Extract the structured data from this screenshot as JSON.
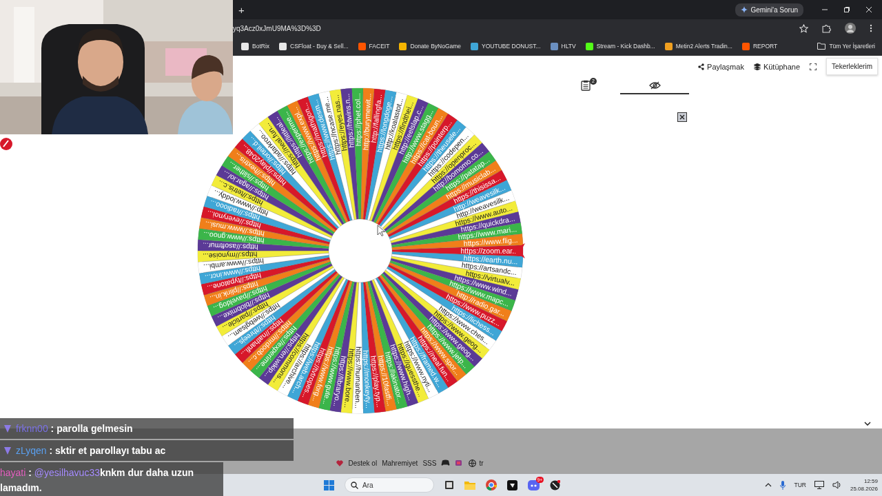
{
  "browser": {
    "new_tab": "+",
    "assistant_button": "Gemini'a Sorun",
    "address": "yq3Acz0xJmU9MA%3D%3D",
    "bookmarks": [
      {
        "label": "BotRix",
        "color": "#e8e8e8"
      },
      {
        "label": "CSFloat - Buy & Sell...",
        "color": "#e8e8e8"
      },
      {
        "label": "FACEIT",
        "color": "#ff5500"
      },
      {
        "label": "Donate ByNoGame",
        "color": "#f5b400"
      },
      {
        "label": "YOUTUBE DONUST...",
        "color": "#3fa6d6"
      },
      {
        "label": "HLTV",
        "color": "#6a8fc0"
      },
      {
        "label": "Stream - Kick Dashb...",
        "color": "#53fc18"
      },
      {
        "label": "Metin2 Alerts Tradin...",
        "color": "#f0a020"
      },
      {
        "label": "REPORT",
        "color": "#ff5500"
      }
    ],
    "all_bookmarks": "Tüm Yer İşaretleri"
  },
  "header": {
    "share": "Paylaşmak",
    "library": "Kütüphane",
    "my_wheels": "Tekerleklerim"
  },
  "panel_tabs": [
    {
      "kind": "entries",
      "badge": "2",
      "selected": false
    },
    {
      "kind": "hidden",
      "selected": true
    }
  ],
  "wheel": {
    "segments": [
      {
        "label": "https://zoom.ear...",
        "color": "#d7182a"
      },
      {
        "label": "https://earth.nu...",
        "color": "#3fa6d6"
      },
      {
        "label": "https://artsandc...",
        "color": "#ffffff"
      },
      {
        "label": "https://virtualv...",
        "color": "#f2ec3a"
      },
      {
        "label": "https://www.wind...",
        "color": "#5b3a96"
      },
      {
        "label": "https://www.mapc...",
        "color": "#3bb54a"
      },
      {
        "label": "http://radio.gar...",
        "color": "#f07f1a"
      },
      {
        "label": "https://www.puzz...",
        "color": "#d7182a"
      },
      {
        "label": "https://lichess...",
        "color": "#3fa6d6"
      },
      {
        "label": "https://www.ches...",
        "color": "#ffffff"
      },
      {
        "label": "https://www.geog...",
        "color": "#f2ec3a"
      },
      {
        "label": "https://www.geog...",
        "color": "#5b3a96"
      },
      {
        "label": "https://www.jetp...",
        "color": "#3bb54a"
      },
      {
        "label": "https://www.spor...",
        "color": "#f07f1a"
      },
      {
        "label": "https://neal.fun...",
        "color": "#d7182a"
      },
      {
        "label": "https://framed.w...",
        "color": "#3fa6d6"
      },
      {
        "label": "https://www.nyti...",
        "color": "#ffffff"
      },
      {
        "label": "https://guessthe...",
        "color": "#f2ec3a"
      },
      {
        "label": "https://www.high...",
        "color": "#5b3a96"
      },
      {
        "label": "https://akinator...",
        "color": "#3bb54a"
      },
      {
        "label": "https://10fastfi...",
        "color": "#f07f1a"
      },
      {
        "label": "https://play.typ...",
        "color": "#d7182a"
      },
      {
        "label": "https://monkeyty...",
        "color": "#3fa6d6"
      },
      {
        "label": "https://humanben...",
        "color": "#ffffff"
      },
      {
        "label": "https://www.bore...",
        "color": "#f2ec3a"
      },
      {
        "label": "https://libraryo...",
        "color": "#5b3a96"
      },
      {
        "label": "https://www.gute...",
        "color": "#3bb54a"
      },
      {
        "label": "https://www.forg...",
        "color": "#f07f1a"
      },
      {
        "label": "https://tvtropes...",
        "color": "#d7182a"
      },
      {
        "label": "https://web.arch...",
        "color": "#3fa6d6"
      },
      {
        "label": "https://archive...",
        "color": "#ffffff"
      },
      {
        "label": "https://commons...",
        "color": "#f2ec3a"
      },
      {
        "label": "https://en.wikip...",
        "color": "#5b3a96"
      },
      {
        "label": "https://experime...",
        "color": "#3bb54a"
      },
      {
        "label": "https://mrdoob.c...",
        "color": "#f07f1a"
      },
      {
        "label": "https://nathanfi...",
        "color": "#d7182a"
      },
      {
        "label": "https://threejs...",
        "color": "#3fa6d6"
      },
      {
        "label": "https://webglsam...",
        "color": "#ffffff"
      },
      {
        "label": "https://particle...",
        "color": "#f2ec3a"
      },
      {
        "label": "https://blobmixe...",
        "color": "#5b3a96"
      },
      {
        "label": "https://paveldog...",
        "color": "#3bb54a"
      },
      {
        "label": "https://plink.in...",
        "color": "#f07f1a"
      },
      {
        "label": "https://typatone...",
        "color": "#d7182a"
      },
      {
        "label": "https://www.incr...",
        "color": "#3fa6d6"
      },
      {
        "label": "https://www.ambi...",
        "color": "#ffffff"
      },
      {
        "label": "https://mynoise...",
        "color": "#f2ec3a"
      },
      {
        "label": "https://asoftmur...",
        "color": "#5b3a96"
      },
      {
        "label": "https://www.gnoo...",
        "color": "#3bb54a"
      },
      {
        "label": "https://www.musi...",
        "color": "#f07f1a"
      },
      {
        "label": "https://everynoi...",
        "color": "#d7182a"
      },
      {
        "label": "https://radiooo...",
        "color": "#3fa6d6"
      },
      {
        "label": "http://www.loddy...",
        "color": "#ffffff"
      },
      {
        "label": "https://tetris.c...",
        "color": "#f2ec3a"
      },
      {
        "label": "https://agar.io/...",
        "color": "#5b3a96"
      },
      {
        "label": "https://slither...",
        "color": "#3bb54a"
      },
      {
        "label": "https://hextris...",
        "color": "#f07f1a"
      },
      {
        "label": "https://play2048...",
        "color": "#d7182a"
      },
      {
        "label": "https://orteil.d...",
        "color": "#3fa6d6"
      },
      {
        "label": "https://adarkroo...",
        "color": "#ffffff"
      },
      {
        "label": "https://neal.fun...",
        "color": "#f2ec3a"
      },
      {
        "label": "https://littleal...",
        "color": "#5b3a96"
      },
      {
        "label": "https://experime...",
        "color": "#3bb54a"
      },
      {
        "label": "https://www.expl...",
        "color": "#f07f1a"
      },
      {
        "label": "https://mathigon...",
        "color": "#d7182a"
      },
      {
        "label": "https://www.desm...",
        "color": "#3fa6d6"
      },
      {
        "label": "https://ncase.me...",
        "color": "#ffffff"
      },
      {
        "label": "https://eyes.nas...",
        "color": "#f2ec3a"
      },
      {
        "label": "https://htwins.n...",
        "color": "#5b3a96"
      },
      {
        "label": "https://phet.col...",
        "color": "#3bb54a"
      },
      {
        "label": "http://burymewit...",
        "color": "#f07f1a"
      },
      {
        "label": "http://fallingfa...",
        "color": "#d7182a"
      },
      {
        "label": "https://longdoge...",
        "color": "#3fa6d6"
      },
      {
        "label": "http://koalastot...",
        "color": "#ffffff"
      },
      {
        "label": "https://findthei...",
        "color": "#f2ec3a"
      },
      {
        "label": "http://eelslap.c...",
        "color": "#5b3a96"
      },
      {
        "label": "http://www.stagg...",
        "color": "#3bb54a"
      },
      {
        "label": "https://cat-boun...",
        "color": "#f07f1a"
      },
      {
        "label": "https://pointerp...",
        "color": "#d7182a"
      },
      {
        "label": "https://theusele...",
        "color": "#3fa6d6"
      },
      {
        "label": "https://codepen...",
        "color": "#ffffff"
      },
      {
        "label": "https://openproc...",
        "color": "#f2ec3a"
      },
      {
        "label": "http://bomomo.co...",
        "color": "#5b3a96"
      },
      {
        "label": "https://patatap...",
        "color": "#3bb54a"
      },
      {
        "label": "https://musiclab...",
        "color": "#f07f1a"
      },
      {
        "label": "https://thisissa...",
        "color": "#d7182a"
      },
      {
        "label": "http://weavesilk...",
        "color": "#3fa6d6"
      },
      {
        "label": "http://weavesilk...",
        "color": "#ffffff"
      },
      {
        "label": "https://www.auto...",
        "color": "#f2ec3a"
      },
      {
        "label": "https://quickdra...",
        "color": "#5b3a96"
      },
      {
        "label": "https://www.mari...",
        "color": "#3bb54a"
      },
      {
        "label": "https://www.flig...",
        "color": "#f07f1a"
      }
    ]
  },
  "footer": {
    "links": [
      "Destek ol",
      "Mahremiyet",
      "SSS"
    ],
    "language": "tr"
  },
  "chat": [
    {
      "user": "frknn00",
      "color": "#7a70e8",
      "separator": ":",
      "message": "parolla gelmesin"
    },
    {
      "user": "zLyqen",
      "color": "#5aa0f0",
      "separator": ":",
      "message": "sktir et parollayı tabu ac"
    },
    {
      "user": "hayati",
      "color": "#e35fbf",
      "separator": ":",
      "mention": "@yesilhavuc33",
      "lines": [
        "knkm dur daha uzun",
        "lamadım."
      ]
    }
  ],
  "taskbar": {
    "search": "Ara",
    "chat_badge": "9+",
    "language": "TUR",
    "time": "12:59",
    "date": "25.08.2026"
  }
}
